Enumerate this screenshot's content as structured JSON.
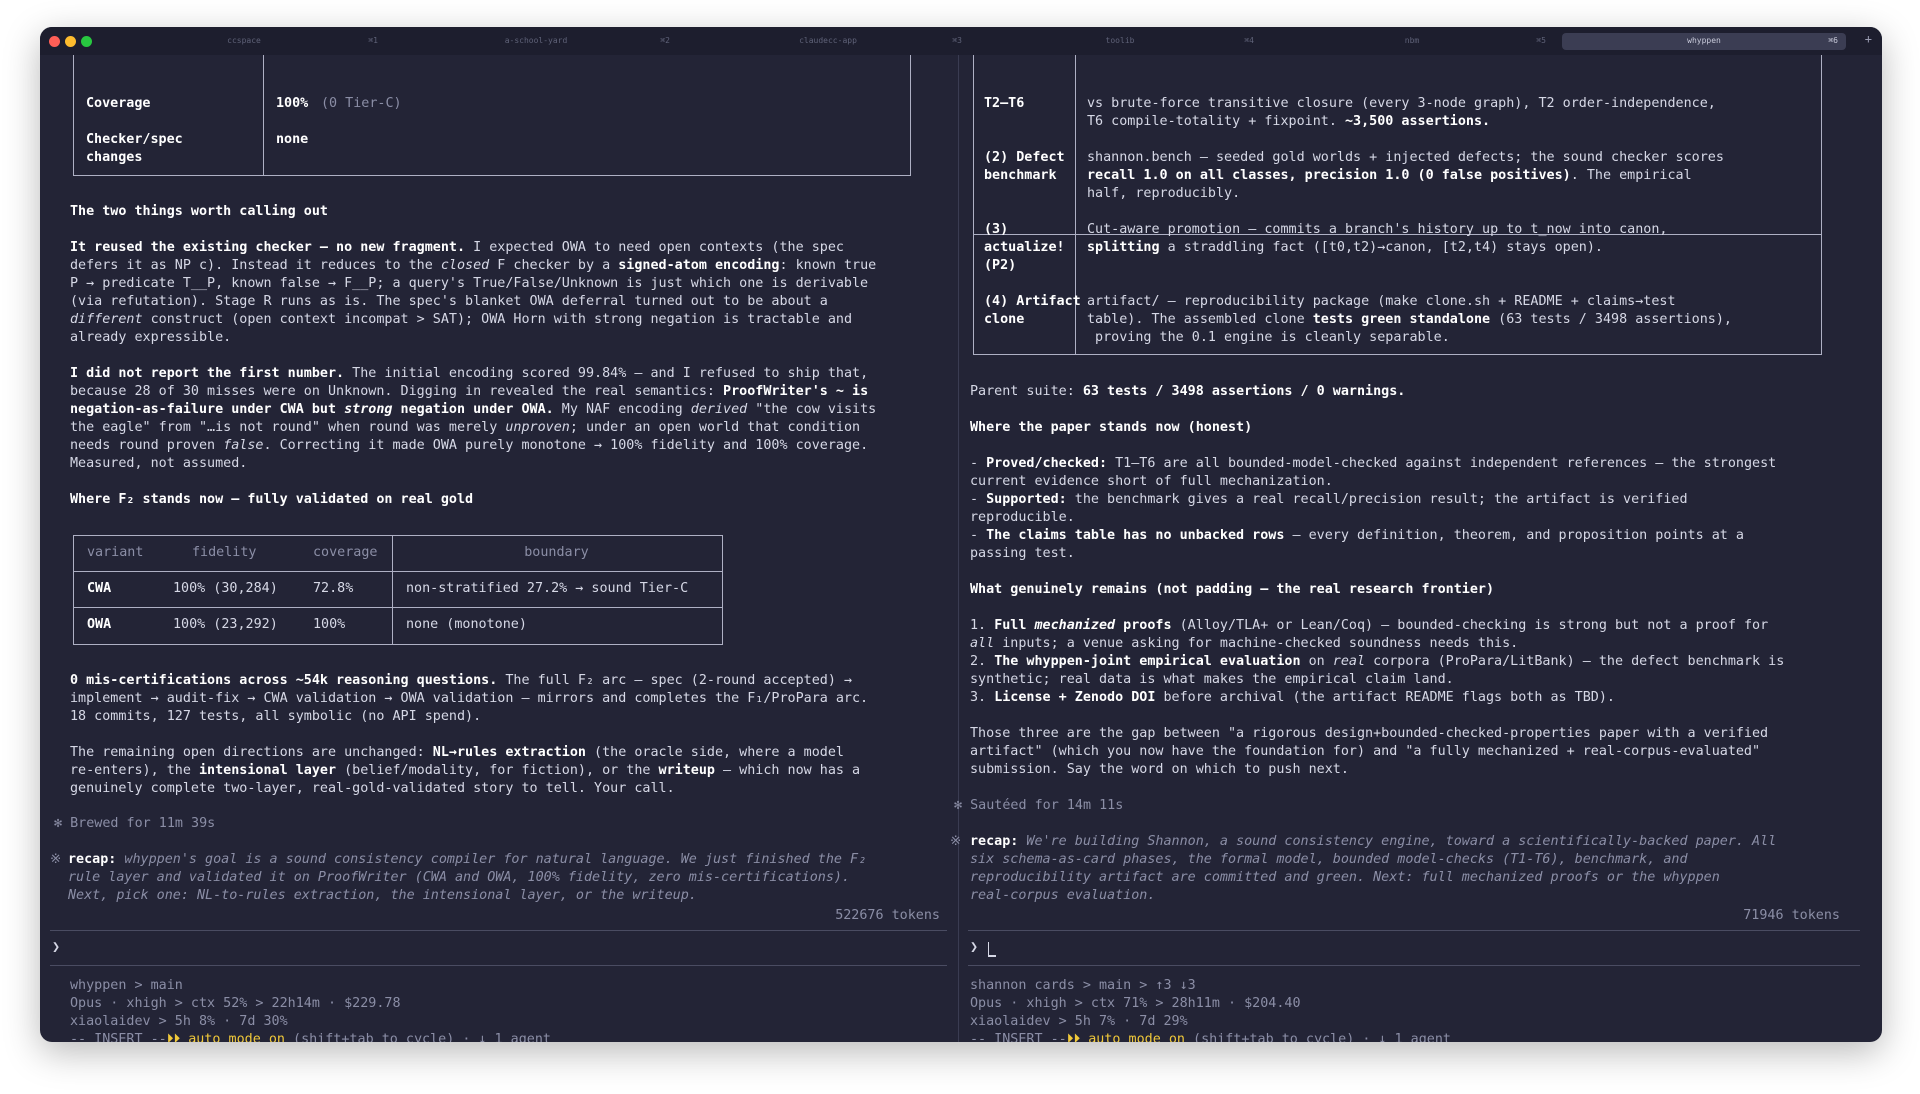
{
  "window": {
    "tabs": [
      {
        "label": "ccspace",
        "key": "⌘1"
      },
      {
        "label": "a-school-yard",
        "key": "⌘2"
      },
      {
        "label": "claudecc-app",
        "key": "⌘3"
      },
      {
        "label": "toolib",
        "key": "⌘4"
      },
      {
        "label": "nbm",
        "key": "⌘5"
      },
      {
        "label": "whyppen",
        "key": "⌘6"
      }
    ],
    "active_tab": "whyppen",
    "new_tab": "+"
  },
  "left": {
    "top_table": {
      "coverage_label": "Coverage",
      "coverage_value": "100%",
      "coverage_note": "(0 Tier-C)",
      "checker_label_1": "Checker/spec",
      "checker_label_2": "changes",
      "checker_value": "none"
    },
    "h1": "The two things worth calling out",
    "p1": [
      [
        {
          "t": "It reused the existing checker — no new fragment.",
          "s": "b"
        },
        {
          "t": " I expected OWA to need open contexts (the spec"
        }
      ],
      [
        {
          "t": "defers it as NP c). Instead it reduces to the "
        },
        {
          "t": "closed",
          "s": "i"
        },
        {
          "t": " F checker by a "
        },
        {
          "t": "signed-atom encoding",
          "s": "b"
        },
        {
          "t": ": known true"
        }
      ],
      [
        {
          "t": "P → predicate T__P, known false → F__P; a query's True/False/Unknown is just which one is derivable"
        }
      ],
      [
        {
          "t": "(via refutation). Stage R runs as is. The spec's blanket OWA deferral turned out to be about a"
        }
      ],
      [
        {
          "t": "different",
          "s": "i"
        },
        {
          "t": " construct (open context incompat > SAT); OWA Horn with strong negation is tractable and"
        }
      ],
      [
        {
          "t": "already expressible."
        }
      ]
    ],
    "p2": [
      [
        {
          "t": "I did not report the first number.",
          "s": "b"
        },
        {
          "t": " The initial encoding scored 99.84% — and I refused to ship that,"
        }
      ],
      [
        {
          "t": "because 28 of 30 misses were on Unknown. Digging in revealed the real semantics: "
        },
        {
          "t": "ProofWriter's ~ is",
          "s": "b"
        }
      ],
      [
        {
          "t": "negation-as-failure under CWA but ",
          "s": "b"
        },
        {
          "t": "strong",
          "s": "bi"
        },
        {
          "t": " negation under OWA.",
          "s": "b"
        },
        {
          "t": " My NAF encoding "
        },
        {
          "t": "derived",
          "s": "i"
        },
        {
          "t": " \"the cow visits"
        }
      ],
      [
        {
          "t": "the eagle\" from \"…is not round\" when round was merely "
        },
        {
          "t": "unproven",
          "s": "i"
        },
        {
          "t": "; under an open world that condition"
        }
      ],
      [
        {
          "t": "needs round proven "
        },
        {
          "t": "false",
          "s": "i"
        },
        {
          "t": ". Correcting it made OWA purely monotone → 100% fidelity and 100% coverage."
        }
      ],
      [
        {
          "t": "Measured, not assumed."
        }
      ]
    ],
    "h2": "Where F₂ stands now — fully validated on real gold",
    "variant_table": {
      "headers": [
        "variant",
        "fidelity",
        "coverage",
        "boundary"
      ],
      "rows": [
        {
          "variant": "CWA",
          "fidelity": "100% (30,284)",
          "coverage": "72.8%",
          "boundary": "non-stratified 27.2% → sound Tier-C"
        },
        {
          "variant": "OWA",
          "fidelity": "100% (23,292)",
          "coverage": "100%",
          "boundary": "none (monotone)"
        }
      ]
    },
    "p3": [
      [
        {
          "t": "0 mis-certifications across ~54k reasoning questions.",
          "s": "b"
        },
        {
          "t": " The full F₂ arc — spec (2-round accepted) →"
        }
      ],
      [
        {
          "t": "implement → audit-fix → CWA validation → OWA validation — mirrors and completes the F₁/ProPara arc."
        }
      ],
      [
        {
          "t": "18 commits, 127 tests, all symbolic (no API spend)."
        }
      ]
    ],
    "p4": [
      [
        {
          "t": "The remaining open directions are unchanged: "
        },
        {
          "t": "NL→rules extraction",
          "s": "b"
        },
        {
          "t": " (the oracle side, where a model"
        }
      ],
      [
        {
          "t": "re-enters), the "
        },
        {
          "t": "intensional layer",
          "s": "b"
        },
        {
          "t": " (belief/modality, for fiction), or the "
        },
        {
          "t": "writeup",
          "s": "b"
        },
        {
          "t": " — which now has a"
        }
      ],
      [
        {
          "t": "genuinely complete two-layer, real-gold-validated story to tell. Your call."
        }
      ]
    ],
    "brewed": "✻ Brewed for 11m 39s",
    "recap_marker": "※",
    "recap_label": "recap:",
    "recap": [
      " whyppen's goal is a sound consistency compiler for natural language. We just finished the F₂",
      "rule layer and validated it on ProofWriter (CWA and OWA, 100% fidelity, zero mis-certifications).",
      "Next, pick one: NL-to-rules extraction, the intensional layer, or the writeup."
    ],
    "tokens": "522676 tokens",
    "prompt": "❯",
    "status": {
      "line1": "whyppen > main",
      "line2": "Opus · xhigh > ctx 52% > 22h14m · $229.78",
      "line3": "xiaolaidev > 5h 8% · 7d 30%",
      "mode_prefix": "-- INSERT --",
      "mode_arrows": "⏵⏵",
      "mode_text": " auto mode on",
      "mode_suffix": " (shift+tab to cycle) · ↓ 1 agent"
    }
  },
  "right": {
    "table": {
      "row1_label": "T2–T6",
      "row1": [
        [
          {
            "t": "vs brute-force transitive closure (every 3-node graph), T2 order-independence,"
          }
        ],
        [
          {
            "t": "T6 compile-totality + fixpoint. "
          },
          {
            "t": "~3,500 assertions.",
            "s": "b"
          }
        ]
      ],
      "row2_label": [
        "(2) Defect",
        "benchmark"
      ],
      "row2": [
        [
          {
            "t": "shannon.bench — seeded gold worlds + injected defects; the sound checker scores"
          }
        ],
        [
          {
            "t": "recall 1.0 on all classes, precision 1.0 (0 false positives)",
            "s": "b"
          },
          {
            "t": ". The empirical"
          }
        ],
        [
          {
            "t": "half, reproducibly."
          }
        ]
      ],
      "row3_label": [
        "(3)",
        "actualize!",
        "(P2)"
      ],
      "row3": [
        [
          {
            "t": "Cut-aware promotion — commits a branch's history up to t_now into canon,"
          }
        ],
        [
          {
            "t": "splitting",
            "s": "b"
          },
          {
            "t": " a straddling fact ([t0,t2)→canon, [t2,t4) stays open)."
          }
        ]
      ],
      "row4_label": [
        "(4) Artifact",
        "clone"
      ],
      "row4": [
        [
          {
            "t": "artifact/ — reproducibility package (make clone.sh + README + claims→test"
          }
        ],
        [
          {
            "t": "table). The assembled clone "
          },
          {
            "t": "tests green standalone",
            "s": "b"
          },
          {
            "t": " (63 tests / 3498 assertions),"
          }
        ],
        [
          {
            "t": " proving the 0.1 engine is cleanly separable."
          }
        ]
      ]
    },
    "suite": [
      [
        {
          "t": "Parent suite: "
        },
        {
          "t": "63 tests / 3498 assertions / 0 warnings.",
          "s": "b"
        }
      ]
    ],
    "h3": "Where the paper stands now (honest)",
    "paper": [
      [
        {
          "t": "- "
        },
        {
          "t": "Proved/checked:",
          "s": "b"
        },
        {
          "t": " T1–T6 are all bounded-model-checked against independent references — the strongest"
        }
      ],
      [
        {
          "t": "current evidence short of full mechanization."
        }
      ],
      [
        {
          "t": "- "
        },
        {
          "t": "Supported:",
          "s": "b"
        },
        {
          "t": " the benchmark gives a real recall/precision result; the artifact is verified"
        }
      ],
      [
        {
          "t": "reproducible."
        }
      ],
      [
        {
          "t": "- "
        },
        {
          "t": "The claims table has no unbacked rows",
          "s": "b"
        },
        {
          "t": " — every definition, theorem, and proposition points at a"
        }
      ],
      [
        {
          "t": "passing test."
        }
      ]
    ],
    "h4": "What genuinely remains (not padding — the real research frontier)",
    "remains": [
      [
        {
          "t": "1. "
        },
        {
          "t": "Full ",
          "s": "b"
        },
        {
          "t": "mechanized",
          "s": "bi"
        },
        {
          "t": " proofs",
          "s": "b"
        },
        {
          "t": " (Alloy/TLA+ or Lean/Coq) — bounded-checking is strong but not a proof for"
        }
      ],
      [
        {
          "t": "all",
          "s": "i"
        },
        {
          "t": " inputs; a venue asking for machine-checked soundness needs this."
        }
      ],
      [
        {
          "t": "2. "
        },
        {
          "t": "The whyppen-joint empirical evaluation",
          "s": "b"
        },
        {
          "t": " on "
        },
        {
          "t": "real",
          "s": "i"
        },
        {
          "t": " corpora (ProPara/LitBank) — the defect benchmark is"
        }
      ],
      [
        {
          "t": "synthetic; real data is what makes the empirical claim land."
        }
      ],
      [
        {
          "t": "3. "
        },
        {
          "t": "License + Zenodo DOI",
          "s": "b"
        },
        {
          "t": " before archival (the artifact README flags both as TBD)."
        }
      ]
    ],
    "closing": [
      [
        {
          "t": "Those three are the gap between \"a rigorous design+bounded-checked-properties paper with a verified"
        }
      ],
      [
        {
          "t": "artifact\" (which you now have the foundation for) and \"a fully mechanized + real-corpus-evaluated\""
        }
      ],
      [
        {
          "t": "submission. Say the word on which to push next."
        }
      ]
    ],
    "sauteed": "✻ Sautéed for 14m 11s",
    "recap_marker": "※",
    "recap_label": "recap:",
    "recap": [
      " We're building Shannon, a sound consistency engine, toward a scientifically-backed paper. All",
      "six schema-as-card phases, the formal model, bounded model-checks (T1-T6), benchmark, and",
      "reproducibility artifact are committed and green. Next: full mechanized proofs or the whyppen",
      "real-corpus evaluation."
    ],
    "tokens": "71946 tokens",
    "prompt": "❯",
    "status": {
      "line1": "shannon cards > main > ↑3 ↓3",
      "line2": "Opus · xhigh > ctx 71% > 28h11m · $204.40",
      "line3": "xiaolaidev > 5h 7% · 7d 29%",
      "mode_prefix": "-- INSERT --",
      "mode_arrows": "⏵⏵",
      "mode_text": " auto mode on",
      "mode_suffix": " (shift+tab to cycle) · ↓ 1 agent"
    }
  },
  "colors": {
    "background": "#232436",
    "text": "#d6d8e6",
    "dim": "#8b8ea6",
    "accent_yellow": "#f0c93a",
    "red": "#ff5f57",
    "yellow": "#febc2e",
    "green": "#28c840"
  }
}
